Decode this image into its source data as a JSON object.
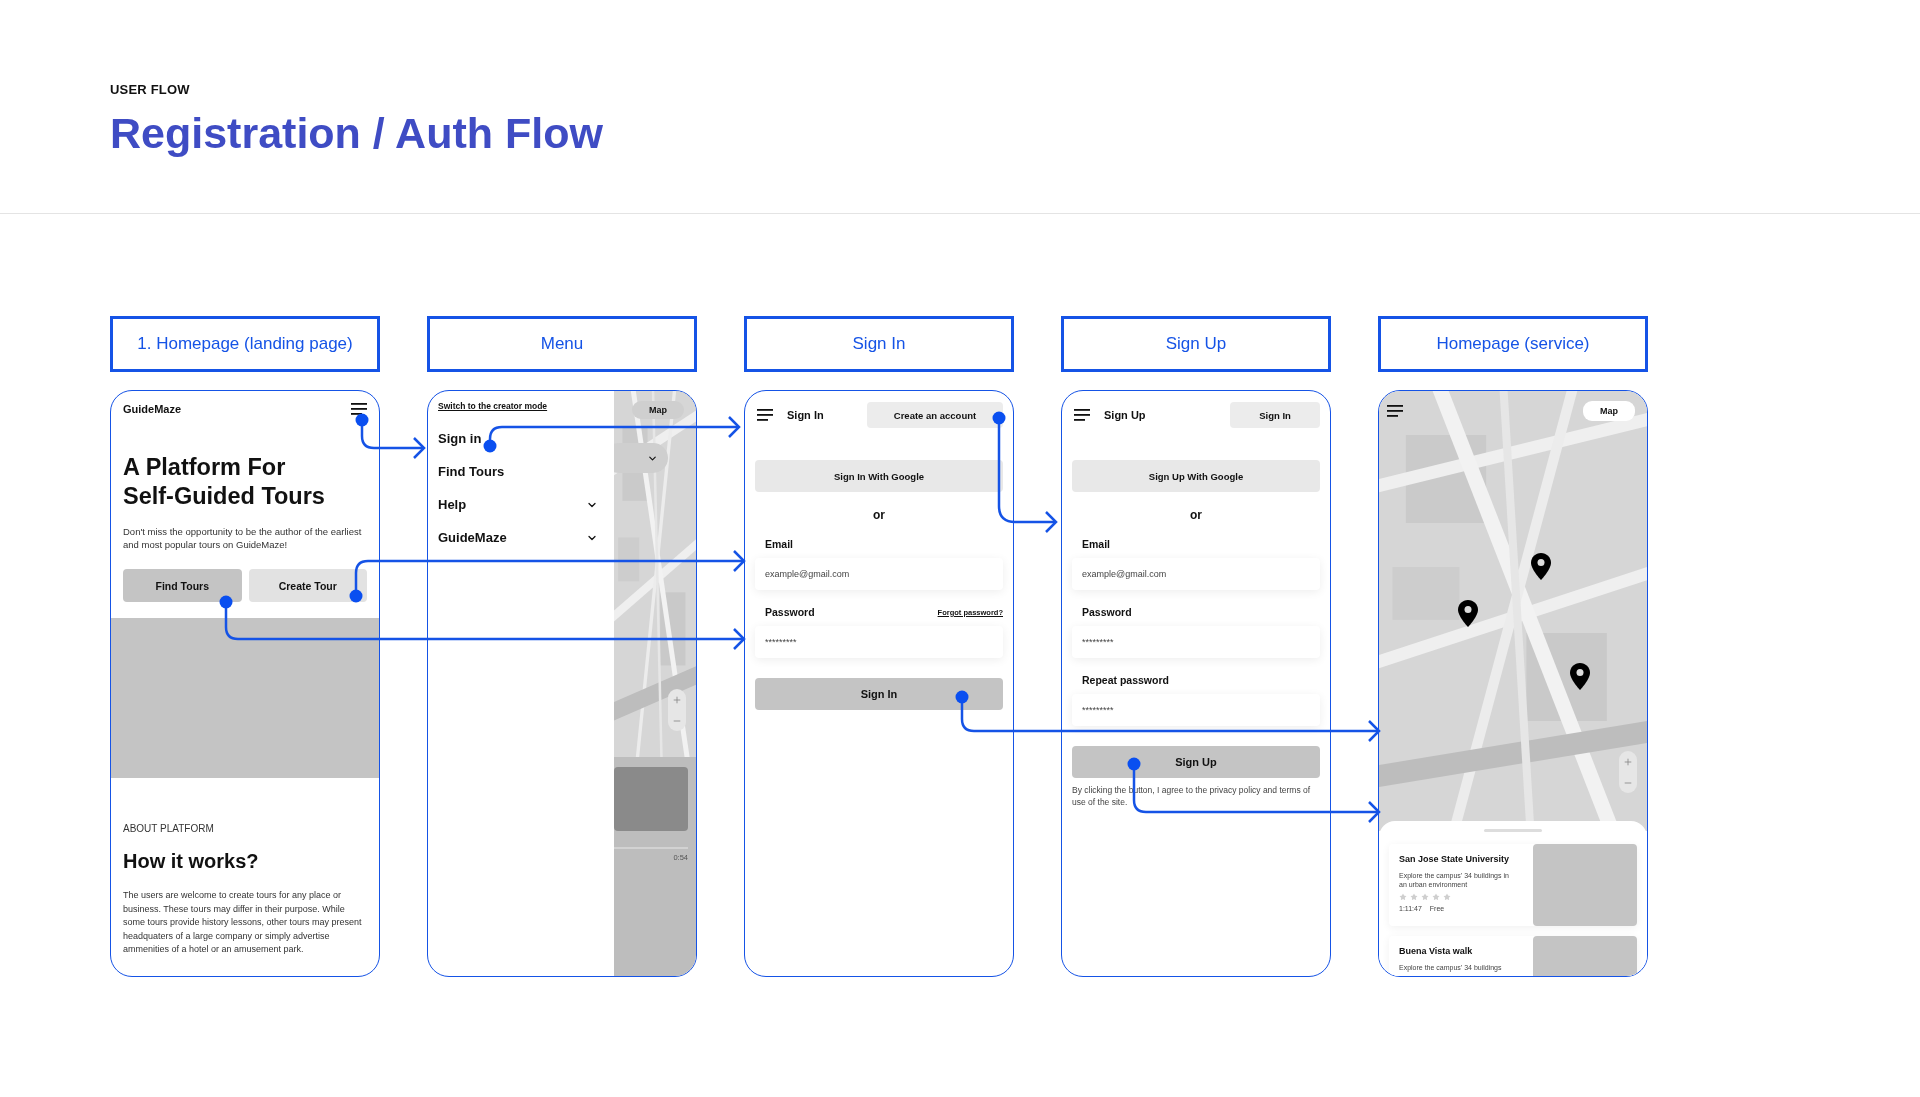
{
  "header": {
    "eyebrow": "USER FLOW",
    "title": "Registration / Auth Flow"
  },
  "screens": [
    {
      "kind": "landing",
      "label": "1. Homepage (landing page)",
      "brand": "GuideMaze",
      "headline": "A Platform For\nSelf-Guided Tours",
      "intro": "Don't miss the opportunity to be the author of the earliest and most popular tours on GuideMaze!",
      "buttons": [
        {
          "label": "Find Tours",
          "primary": true
        },
        {
          "label": "Create Tour",
          "primary": false
        }
      ],
      "section_label": "ABOUT PLATFORM",
      "section_title": "How it works?",
      "body": "The users are welcome to create tours for any place or business. These tours may differ in their purpose. While some tours provide history lessons, other tours may present headquaters of a large company or simply advertise ammenities of a hotel or an amusement park."
    },
    {
      "kind": "menu",
      "label": "Menu",
      "creator_link": "Switch to the creator mode",
      "items": [
        {
          "label": "Sign in",
          "expandable": false
        },
        {
          "label": "Find Tours",
          "expandable": false
        },
        {
          "label": "Help",
          "expandable": true
        },
        {
          "label": "GuideMaze",
          "expandable": true
        }
      ],
      "map_button": "Map",
      "time": "0:54"
    },
    {
      "kind": "form",
      "label": "Sign In",
      "title": "Sign In",
      "top_button": "Create an account",
      "google_button": "Sign In With Google",
      "divider": "or",
      "fields": [
        {
          "label": "Email",
          "value": "example@gmail.com"
        },
        {
          "label": "Password",
          "value": "*********",
          "link": "Forgot password?",
          "has_link": true
        }
      ],
      "submit": "Sign In"
    },
    {
      "kind": "form",
      "label": "Sign Up",
      "title": "Sign Up",
      "top_button": "Sign In",
      "google_button": "Sign Up With Google",
      "divider": "or",
      "fields": [
        {
          "label": "Email",
          "value": "example@gmail.com"
        },
        {
          "label": "Password",
          "value": "*********"
        },
        {
          "label": "Repeat password",
          "value": "*********"
        }
      ],
      "submit": "Sign Up",
      "terms": "By clicking the button, I agree to the privacy policy and terms of use of the site."
    },
    {
      "kind": "service",
      "label": "Homepage (service)",
      "map_button": "Map",
      "tours": [
        {
          "title": "San Jose State University",
          "description": "Explore the campus' 34 buildings in an urban environment",
          "stars": 0,
          "duration": "1:11:47",
          "price": "Free"
        },
        {
          "title": "Buena Vista walk",
          "description": "Explore the campus' 34 buildings"
        }
      ]
    }
  ]
}
